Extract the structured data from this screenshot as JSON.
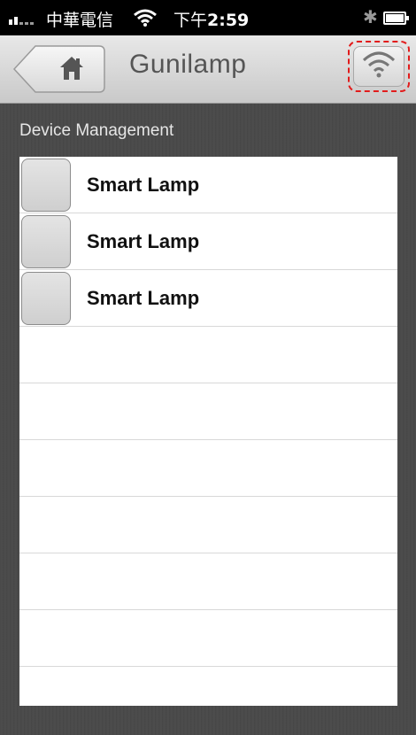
{
  "status_bar": {
    "carrier": "中華電信",
    "time_prefix": "下午",
    "time": "2:59",
    "bluetooth_icon": "bluetooth-icon",
    "battery_icon": "battery-icon",
    "wifi_icon": "wifi-icon"
  },
  "navbar": {
    "title": "Gunilamp",
    "back_icon": "home-icon",
    "wifi_button_icon": "wifi-icon",
    "highlight_color": "#e21b1b"
  },
  "section": {
    "title": "Device Management"
  },
  "devices": [
    {
      "name": "Smart Lamp"
    },
    {
      "name": "Smart Lamp"
    },
    {
      "name": "Smart Lamp"
    }
  ]
}
